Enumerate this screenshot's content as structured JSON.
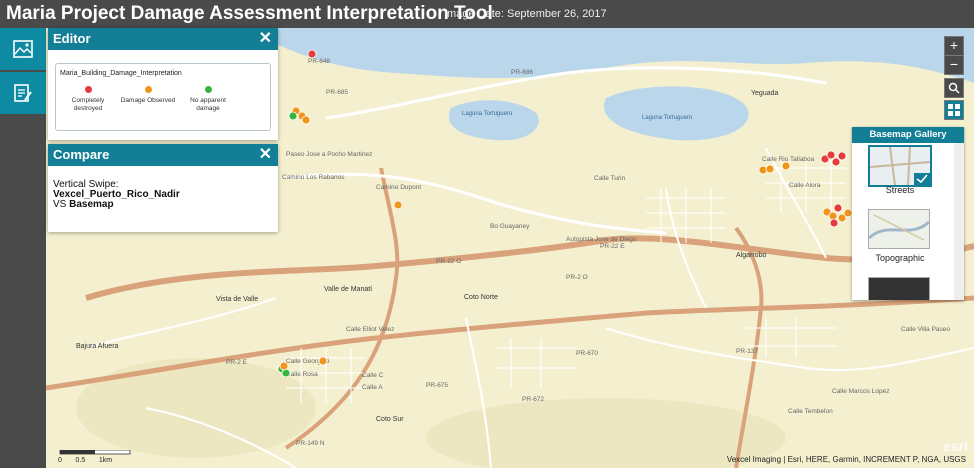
{
  "app": {
    "title": "Maria Project Damage Assessment Interpretation Tool",
    "image_date": "Image Date: September 26, 2017"
  },
  "sidebar": {
    "buttons": [
      {
        "icon": "basemap-gallery-icon"
      },
      {
        "icon": "edit-icon"
      }
    ]
  },
  "editor": {
    "title": "Editor",
    "close": "✕",
    "layer": "Maria_Building_Damage_Interpretation",
    "templates": [
      {
        "label": "Completely destroyed",
        "color": "#e53b3b"
      },
      {
        "label": "Damage Observed",
        "color": "#f2941c"
      },
      {
        "label": "No apparent damage",
        "color": "#37b43f"
      }
    ]
  },
  "compare": {
    "title": "Compare",
    "close": "✕",
    "mode": "Vertical Swipe:",
    "layer": "Vexcel_Puerto_Rico_Nadir",
    "vs": "VS",
    "basemap": "Basemap"
  },
  "map_controls": {
    "zoom_in": "+",
    "zoom_out": "−",
    "search_icon": "search-icon",
    "gallery_icon": "grid-icon"
  },
  "basemap_gallery": {
    "title": "Basemap Gallery",
    "items": [
      {
        "label": "Streets",
        "selected": true
      },
      {
        "label": "Topographic"
      },
      {
        "label": ""
      }
    ]
  },
  "attribution": "Vexcel Imaging | Esri, HERE, Garmin, INCREMENT P, NGA, USGS",
  "logo": "esri",
  "scalebar": {
    "labels": [
      "0",
      "0.5",
      "1km"
    ]
  },
  "map_labels": {
    "lakes": [
      "Laguna Tortuguero",
      "Laguna Tortuguero"
    ],
    "towns": [
      "Yeguada",
      "Vista de Valle",
      "Valle de Manatí",
      "Coto Norte",
      "Algarrobo",
      "Bajura Afuera",
      "Coto Sur"
    ],
    "roads": [
      "PR-648",
      "PR-686",
      "PR-685",
      "Paseo Jose a Pocho Martinez",
      "Camino Los Rabanos",
      "Camino Dupont",
      "Calle Turin",
      "Calle Rio Tallaboa",
      "Calle Alora",
      "Bo Guayaney",
      "Autopista Jose de Diego",
      "PR-22 O",
      "PR-22 E",
      "PR-2 O",
      "PR-2 E",
      "Calle Elliot Velez",
      "Calle Georgetti",
      "Calle Rosa",
      "Calle C",
      "Calle A",
      "PR-670",
      "PR-672",
      "PR-675",
      "PR-149 N",
      "PR-137",
      "Calle Villa Paseo",
      "Calle Tembelon",
      "Calle Marcos Lopez"
    ]
  }
}
